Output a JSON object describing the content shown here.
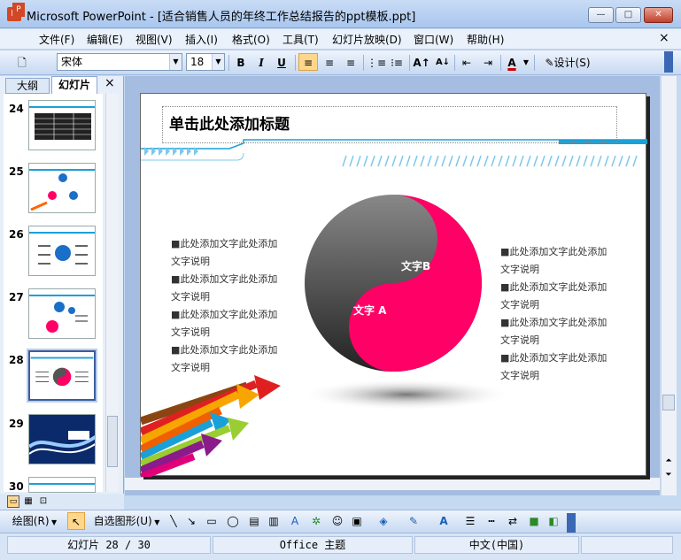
{
  "window": {
    "title": "Microsoft PowerPoint - [适合销售人员的年终工作总结报告的ppt模板.ppt]",
    "min": "—",
    "max": "□",
    "close": "✕"
  },
  "menu": {
    "items": [
      "文件(F)",
      "编辑(E)",
      "视图(V)",
      "插入(I)",
      "格式(O)",
      "工具(T)",
      "幻灯片放映(D)",
      "窗口(W)",
      "帮助(H)"
    ],
    "close": "×"
  },
  "toolbar": {
    "font_name": "宋体",
    "font_size": "18",
    "bold": "B",
    "italic": "I",
    "underline": "U",
    "font_color_label": "A",
    "design_label": "设计(S)"
  },
  "panel": {
    "tab_outline": "大纲",
    "tab_slides": "幻灯片",
    "close": "×",
    "slide_numbers": [
      "24",
      "25",
      "26",
      "27",
      "28",
      "29",
      "30"
    ],
    "selected": "28"
  },
  "slide": {
    "title": "单击此处添加标题",
    "left_bullets": [
      "■此处添加文字此处添加",
      "文字说明",
      "■此处添加文字此处添加",
      "文字说明",
      "■此处添加文字此处添加",
      "文字说明",
      "■此处添加文字此处添加",
      "文字说明"
    ],
    "right_bullets": [
      "■此处添加文字此处添加",
      "文字说明",
      "■此处添加文字此处添加",
      "文字说明",
      "■此处添加文字此处添加",
      "文字说明",
      "■此处添加文字此处添加",
      "文字说明"
    ],
    "label_a": "文字 A",
    "label_b": "文字B",
    "colors": {
      "pink": "#ff0066",
      "grey": "#555555",
      "accent": "#1aa0d8"
    }
  },
  "draw": {
    "draw_menu": "绘图(R)",
    "autoshape_menu": "自选图形(U)"
  },
  "status": {
    "slide_pos": "幻灯片 28 / 30",
    "theme": "Office 主题",
    "language": "中文(中国)"
  }
}
